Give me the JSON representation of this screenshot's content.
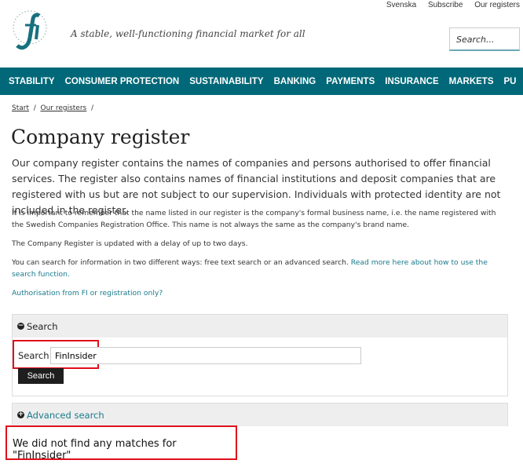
{
  "header": {
    "top_links": [
      "Svenska",
      "Subscribe",
      "Our registers"
    ],
    "logo_text": "FINANSINSPEKTIONEN fi",
    "tagline": "A stable, well-functioning financial market for all",
    "search_placeholder": "Search..."
  },
  "nav": [
    "STABILITY",
    "CONSUMER PROTECTION",
    "SUSTAINABILITY",
    "BANKING",
    "PAYMENTS",
    "INSURANCE",
    "MARKETS",
    "PU"
  ],
  "breadcrumb": [
    "Start",
    "Our registers"
  ],
  "page": {
    "title": "Company register",
    "lead": "Our company register contains the names of companies and persons authorised to offer financial services. The register also contains names of financial institutions and deposit companies that are registered with us but are not subject to our supervision. Individuals with protected identity are not included in the register.",
    "p1": "It is important to remember that the name listed in our register is the company's formal business name, i.e. the name registered with the Swedish Companies Registration Office. This name is not always the same as the company's brand name.",
    "p2": "The Company Register is updated with a delay of up to two days.",
    "p3": "You can search for information in two different ways: free text search or an advanced search. ",
    "p3_link": "Read more here about how to use the search function.",
    "auth_link": "Authorisation from FI or registration only?"
  },
  "search_panel": {
    "header": "Search",
    "label": "Search",
    "value": "FinInsider",
    "button": "Search"
  },
  "advanced": {
    "header": "Advanced search"
  },
  "result": "We did not find any matches for \"FinInsider\"",
  "colors": {
    "nav": "#006878",
    "link": "#1a7a8c",
    "highlight": "#e0101a"
  }
}
